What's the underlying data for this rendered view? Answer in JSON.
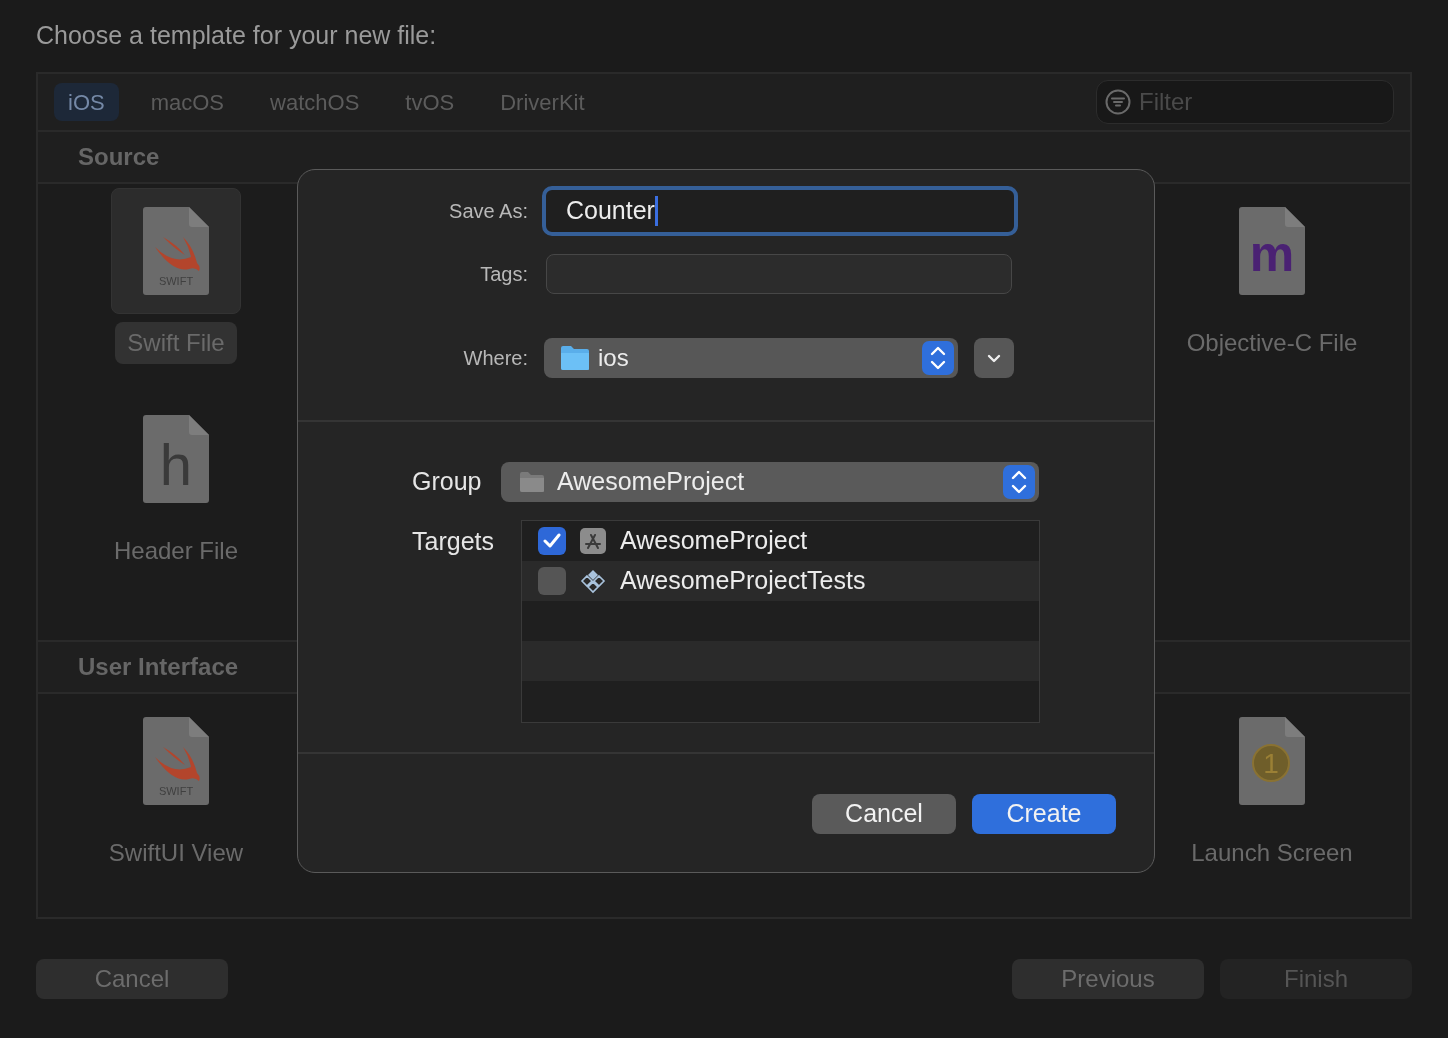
{
  "window": {
    "title": "Choose a template for your new file:"
  },
  "platform_tabs": [
    {
      "label": "iOS",
      "selected": true
    },
    {
      "label": "macOS",
      "selected": false
    },
    {
      "label": "watchOS",
      "selected": false
    },
    {
      "label": "tvOS",
      "selected": false
    },
    {
      "label": "DriverKit",
      "selected": false
    }
  ],
  "filter": {
    "placeholder": "Filter"
  },
  "sections": [
    {
      "title": "Source",
      "rows": [
        [
          {
            "label": "Swift File",
            "kind": "swift",
            "icon_text": "SWIFT",
            "selected": true
          },
          {
            "label": "Objective-C File",
            "kind": "objc",
            "icon_text": "m",
            "selected": false
          }
        ],
        [
          {
            "label": "Header File",
            "kind": "header",
            "icon_text": "h",
            "selected": false
          }
        ]
      ]
    },
    {
      "title": "User Interface",
      "rows": [
        [
          {
            "label": "SwiftUI View",
            "kind": "swift",
            "icon_text": "SWIFT",
            "selected": false
          },
          {
            "label": "Launch Screen",
            "kind": "storyboard",
            "icon_text": "1",
            "selected": false
          }
        ]
      ]
    }
  ],
  "footer": {
    "buttons": [
      {
        "label": "Cancel",
        "disabled": false
      },
      {
        "label": "Previous",
        "disabled": false
      },
      {
        "label": "Finish",
        "disabled": true
      }
    ]
  },
  "save_sheet": {
    "save_as": {
      "label": "Save As:",
      "value": "Counter"
    },
    "tags": {
      "label": "Tags:"
    },
    "where": {
      "label": "Where:",
      "value": "ios"
    },
    "group": {
      "label": "Group",
      "value": "AwesomeProject"
    },
    "targets": {
      "label": "Targets",
      "items": [
        {
          "name": "AwesomeProject",
          "kind": "app",
          "checked": true
        },
        {
          "name": "AwesomeProjectTests",
          "kind": "tests",
          "checked": false
        }
      ]
    },
    "buttons": [
      {
        "label": "Cancel",
        "kind": "secondary"
      },
      {
        "label": "Create",
        "kind": "primary"
      }
    ]
  }
}
